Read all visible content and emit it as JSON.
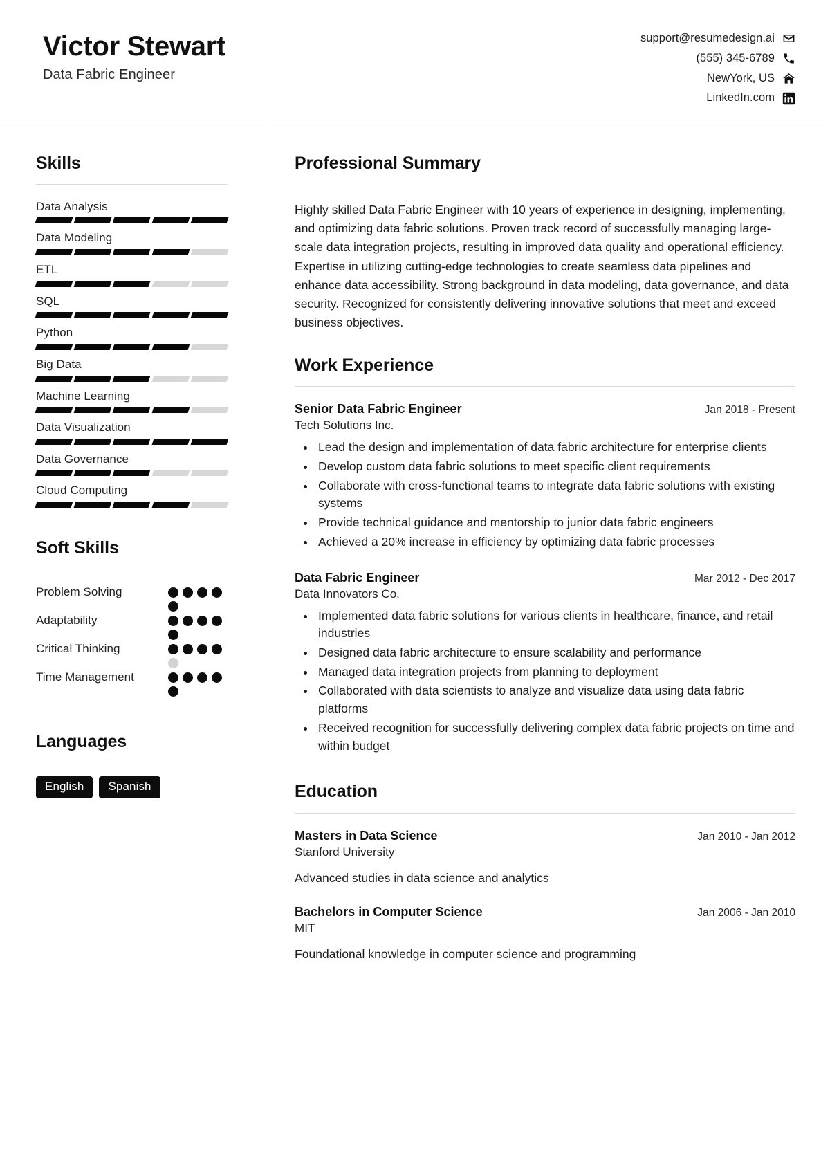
{
  "header": {
    "name": "Victor Stewart",
    "title": "Data Fabric Engineer",
    "contacts": [
      {
        "text": "support@resumedesign.ai",
        "icon": "envelope-icon"
      },
      {
        "text": "(555) 345-6789",
        "icon": "phone-icon"
      },
      {
        "text": "NewYork, US",
        "icon": "home-icon"
      },
      {
        "text": "LinkedIn.com",
        "icon": "linkedin-icon"
      }
    ]
  },
  "sidebar": {
    "skills_title": "Skills",
    "skills": [
      {
        "name": "Data Analysis",
        "level": 5,
        "max": 5
      },
      {
        "name": "Data Modeling",
        "level": 4,
        "max": 5
      },
      {
        "name": "ETL",
        "level": 3,
        "max": 5
      },
      {
        "name": "SQL",
        "level": 5,
        "max": 5
      },
      {
        "name": "Python",
        "level": 4,
        "max": 5
      },
      {
        "name": "Big Data",
        "level": 3,
        "max": 5
      },
      {
        "name": "Machine Learning",
        "level": 4,
        "max": 5
      },
      {
        "name": "Data Visualization",
        "level": 5,
        "max": 5
      },
      {
        "name": "Data Governance",
        "level": 3,
        "max": 5
      },
      {
        "name": "Cloud Computing",
        "level": 4,
        "max": 5
      }
    ],
    "soft_skills_title": "Soft Skills",
    "soft_skills": [
      {
        "name": "Problem Solving",
        "level": 5,
        "max": 5
      },
      {
        "name": "Adaptability",
        "level": 5,
        "max": 5
      },
      {
        "name": "Critical Thinking",
        "level": 4,
        "max": 5
      },
      {
        "name": "Time Management",
        "level": 5,
        "max": 5
      }
    ],
    "languages_title": "Languages",
    "languages": [
      "English",
      "Spanish"
    ]
  },
  "main": {
    "summary_title": "Professional Summary",
    "summary_text": "Highly skilled Data Fabric Engineer with 10 years of experience in designing, implementing, and optimizing data fabric solutions. Proven track record of successfully managing large-scale data integration projects, resulting in improved data quality and operational efficiency. Expertise in utilizing cutting-edge technologies to create seamless data pipelines and enhance data accessibility. Strong background in data modeling, data governance, and data security. Recognized for consistently delivering innovative solutions that meet and exceed business objectives.",
    "work_title": "Work Experience",
    "work": [
      {
        "role": "Senior Data Fabric Engineer",
        "date": "Jan 2018 - Present",
        "org": "Tech Solutions Inc.",
        "bullets": [
          "Lead the design and implementation of data fabric architecture for enterprise clients",
          "Develop custom data fabric solutions to meet specific client requirements",
          "Collaborate with cross-functional teams to integrate data fabric solutions with existing systems",
          "Provide technical guidance and mentorship to junior data fabric engineers",
          "Achieved a 20% increase in efficiency by optimizing data fabric processes"
        ]
      },
      {
        "role": "Data Fabric Engineer",
        "date": "Mar 2012 - Dec 2017",
        "org": "Data Innovators Co.",
        "bullets": [
          "Implemented data fabric solutions for various clients in healthcare, finance, and retail industries",
          "Designed data fabric architecture to ensure scalability and performance",
          "Managed data integration projects from planning to deployment",
          "Collaborated with data scientists to analyze and visualize data using data fabric platforms",
          "Received recognition for successfully delivering complex data fabric projects on time and within budget"
        ]
      }
    ],
    "education_title": "Education",
    "education": [
      {
        "degree": "Masters in Data Science",
        "date": "Jan 2010 - Jan 2012",
        "school": "Stanford University",
        "description": "Advanced studies in data science and analytics"
      },
      {
        "degree": "Bachelors in Computer Science",
        "date": "Jan 2006 - Jan 2010",
        "school": "MIT",
        "description": "Foundational knowledge in computer science and programming"
      }
    ]
  },
  "colors": {
    "accent": "#000000",
    "filled": "#0c0c0c",
    "empty": "#d3d3d3",
    "rule": "#d9d9d9"
  }
}
